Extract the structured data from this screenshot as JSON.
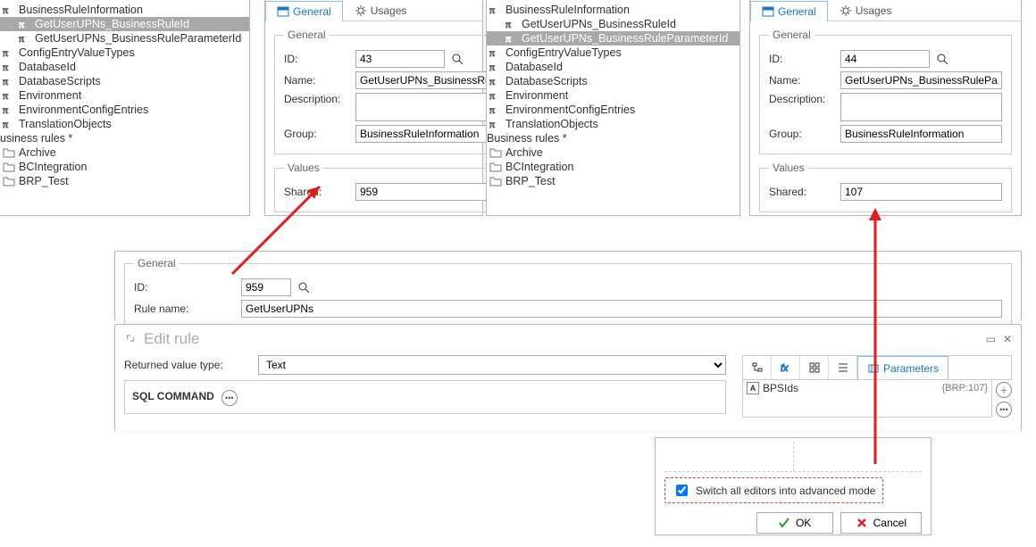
{
  "tabs": {
    "general": "General",
    "usages": "Usages"
  },
  "groups": {
    "general": "General",
    "values": "Values"
  },
  "labels": {
    "id": "ID:",
    "name": "Name:",
    "description": "Description:",
    "group": "Group:",
    "shared": "Shared:",
    "rulename": "Rule name:",
    "retval": "Returned value type:"
  },
  "treeLeft": {
    "items": [
      {
        "icon": "pi",
        "label": "BusinessRuleInformation",
        "indent": 0
      },
      {
        "icon": "pi",
        "label": "GetUserUPNs_BusinessRuleId",
        "indent": 1,
        "selected": true
      },
      {
        "icon": "pi",
        "label": "GetUserUPNs_BusinessRuleParameterId",
        "indent": 1
      },
      {
        "icon": "pi",
        "label": "ConfigEntryValueTypes",
        "indent": 0
      },
      {
        "icon": "pi",
        "label": "DatabaseId",
        "indent": 0
      },
      {
        "icon": "pi",
        "label": "DatabaseScripts",
        "indent": 0
      },
      {
        "icon": "pi",
        "label": "Environment",
        "indent": 0
      },
      {
        "icon": "pi",
        "label": "EnvironmentConfigEntries",
        "indent": 0
      },
      {
        "icon": "pi",
        "label": "TranslationObjects",
        "indent": 0
      },
      {
        "icon": "none",
        "label": "usiness rules *",
        "indent": -1
      },
      {
        "icon": "folder",
        "label": "Archive",
        "indent": 0
      },
      {
        "icon": "folder",
        "label": "BCIntegration",
        "indent": 0
      },
      {
        "icon": "folder",
        "label": "BRP_Test",
        "indent": 0
      }
    ]
  },
  "treeRight": {
    "items": [
      {
        "icon": "pi",
        "label": "BusinessRuleInformation",
        "indent": 0
      },
      {
        "icon": "pi",
        "label": "GetUserUPNs_BusinessRuleId",
        "indent": 1
      },
      {
        "icon": "pi",
        "label": "GetUserUPNs_BusinessRuleParameterId",
        "indent": 1,
        "selected": true
      },
      {
        "icon": "pi",
        "label": "ConfigEntryValueTypes",
        "indent": 0
      },
      {
        "icon": "pi",
        "label": "DatabaseId",
        "indent": 0
      },
      {
        "icon": "pi",
        "label": "DatabaseScripts",
        "indent": 0
      },
      {
        "icon": "pi",
        "label": "Environment",
        "indent": 0
      },
      {
        "icon": "pi",
        "label": "EnvironmentConfigEntries",
        "indent": 0
      },
      {
        "icon": "pi",
        "label": "TranslationObjects",
        "indent": 0
      },
      {
        "icon": "none",
        "label": "Business rules *",
        "indent": -1
      },
      {
        "icon": "folder",
        "label": "Archive",
        "indent": 0
      },
      {
        "icon": "folder",
        "label": "BCIntegration",
        "indent": 0
      },
      {
        "icon": "folder",
        "label": "BRP_Test",
        "indent": 0
      }
    ]
  },
  "formA": {
    "id": "43",
    "name": "GetUserUPNs_BusinessRuleId",
    "description": "",
    "group": "BusinessRuleInformation",
    "shared": "959"
  },
  "formB": {
    "id": "44",
    "name": "GetUserUPNs_BusinessRuleParameterId",
    "description": "",
    "group": "BusinessRuleInformation",
    "shared": "107"
  },
  "lower": {
    "id": "959",
    "rulename": "GetUserUPNs",
    "editrule": "Edit rule",
    "retvalue": "Text",
    "sql": "SQL COMMAND",
    "paramTab": "Parameters",
    "param": {
      "name": "BPSIds",
      "code": "{BRP:107}"
    }
  },
  "bottom": {
    "adv": "Switch all editors into advanced mode",
    "ok": "OK",
    "cancel": "Cancel"
  }
}
